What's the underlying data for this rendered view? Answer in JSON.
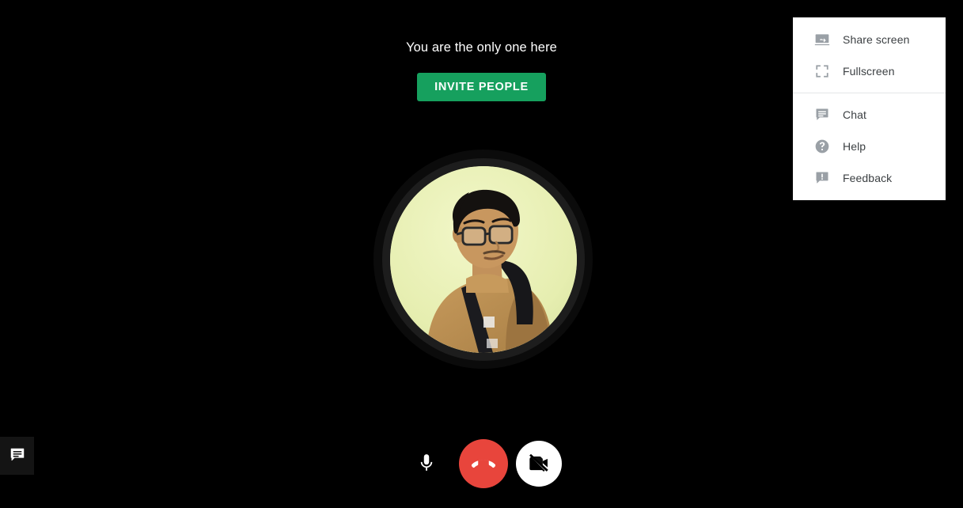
{
  "call": {
    "empty_state_title": "You are the only one here",
    "invite_button_label": "INVITE PEOPLE",
    "background_color": "#000000",
    "accent_green": "#16a05e",
    "hangup_red": "#e8453c"
  },
  "avatar": {
    "name": "self-view-avatar",
    "description": "Circular profile photo of a person wearing glasses and a tan jacket on a pale yellow-green background",
    "backdrop_color": "#e9f0b8"
  },
  "controls": [
    {
      "name": "microphone",
      "icon": "microphone-icon",
      "label": "Mute microphone",
      "state": "on"
    },
    {
      "name": "hangup",
      "icon": "phone-hangup-icon",
      "label": "Leave call",
      "color": "#e8453c"
    },
    {
      "name": "camera",
      "icon": "video-camera-off-icon",
      "label": "Turn on camera",
      "state": "off"
    }
  ],
  "chat_tab": {
    "icon": "chat-bubble-icon",
    "label": "Chat"
  },
  "overflow_menu": {
    "groups": [
      {
        "items": [
          {
            "label": "Share screen",
            "icon": "share-screen-icon"
          },
          {
            "label": "Fullscreen",
            "icon": "fullscreen-icon"
          }
        ]
      },
      {
        "items": [
          {
            "label": "Chat",
            "icon": "chat-icon"
          },
          {
            "label": "Help",
            "icon": "help-circle-icon"
          },
          {
            "label": "Feedback",
            "icon": "feedback-icon"
          }
        ]
      }
    ]
  }
}
